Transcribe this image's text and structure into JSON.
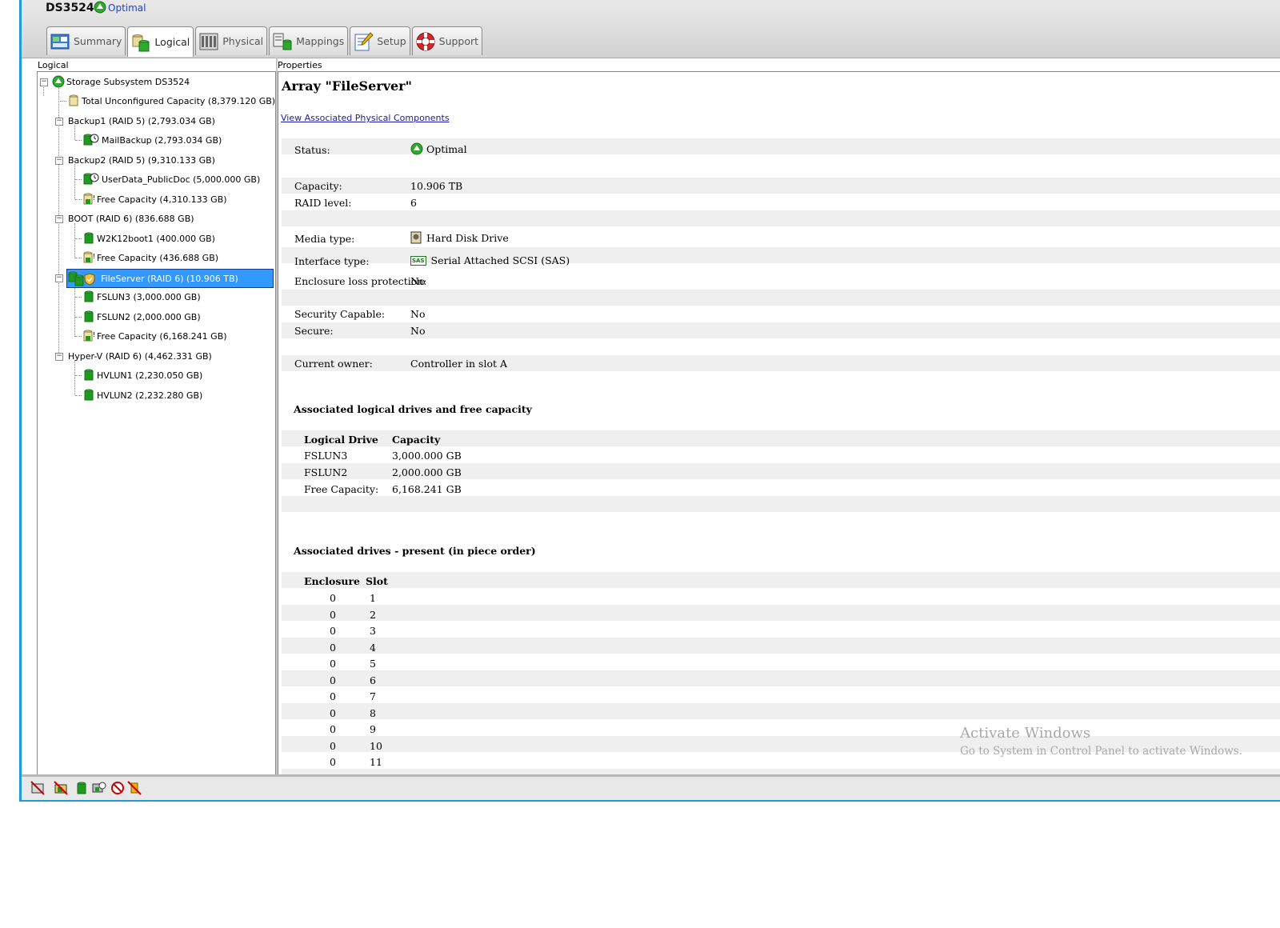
{
  "header": {
    "system_name": "DS3524",
    "status_text": "Optimal",
    "tabs": [
      {
        "label": "Summary"
      },
      {
        "label": "Logical"
      },
      {
        "label": "Physical"
      },
      {
        "label": "Mappings"
      },
      {
        "label": "Setup"
      },
      {
        "label": "Support"
      }
    ]
  },
  "left_panel": {
    "label": "Logical",
    "tree": [
      {
        "label": "Storage Subsystem DS3524",
        "icon": "storage-subsystem-icon"
      },
      {
        "label": "Total Unconfigured Capacity (8,379.120 GB)",
        "icon": "unconfigured-capacity-icon"
      },
      {
        "label": "Backup1 (RAID 5) (2,793.034 GB)",
        "icon": "array-icon"
      },
      {
        "label": "MailBackup (2,793.034 GB)",
        "icon": "logical-drive-clock-icon"
      },
      {
        "label": "Backup2 (RAID 5) (9,310.133 GB)",
        "icon": "array-icon"
      },
      {
        "label": "UserData_PublicDoc (5,000.000 GB)",
        "icon": "logical-drive-clock-icon"
      },
      {
        "label": "Free Capacity (4,310.133 GB)",
        "icon": "free-capacity-icon"
      },
      {
        "label": "BOOT (RAID 6) (836.688 GB)",
        "icon": "array-icon"
      },
      {
        "label": "W2K12boot1 (400.000 GB)",
        "icon": "logical-drive-icon"
      },
      {
        "label": "Free Capacity (436.688 GB)",
        "icon": "free-capacity-icon"
      },
      {
        "label": "FileServer (RAID 6) (10.906 TB)",
        "icon": "secure-array-icon"
      },
      {
        "label": "FSLUN3 (3,000.000 GB)",
        "icon": "logical-drive-icon"
      },
      {
        "label": "FSLUN2 (2,000.000 GB)",
        "icon": "logical-drive-icon"
      },
      {
        "label": "Free Capacity (6,168.241 GB)",
        "icon": "free-capacity-icon"
      },
      {
        "label": "Hyper-V (RAID 6) (4,462.331 GB)",
        "icon": "array-icon"
      },
      {
        "label": "HVLUN1 (2,230.050 GB)",
        "icon": "logical-drive-icon"
      },
      {
        "label": "HVLUN2 (2,232.280 GB)",
        "icon": "logical-drive-icon"
      }
    ]
  },
  "right_panel": {
    "label": "Properties",
    "title": "Array \"FileServer\"",
    "link": "View Associated Physical Components",
    "properties": [
      {
        "label": "Status:",
        "value": "Optimal"
      },
      {
        "label": "Capacity:",
        "value": "10.906 TB"
      },
      {
        "label": "RAID level:",
        "value": "6"
      },
      {
        "label": "Media type:",
        "value": "Hard Disk Drive"
      },
      {
        "label": "Interface type:",
        "value": "Serial Attached SCSI (SAS)"
      },
      {
        "label": "Enclosure loss protection:",
        "value": "No"
      },
      {
        "label": "Security Capable:",
        "value": "No"
      },
      {
        "label": "Secure:",
        "value": "No"
      },
      {
        "label": "Current owner:",
        "value": "Controller in slot A"
      }
    ],
    "sas_badge": "SAS",
    "logical_section": {
      "title": "Associated logical drives and free capacity",
      "headers": [
        "Logical Drive",
        "Capacity"
      ],
      "rows": [
        [
          "FSLUN3",
          "3,000.000 GB"
        ],
        [
          "FSLUN2",
          "2,000.000 GB"
        ],
        [
          "Free Capacity:",
          "6,168.241 GB"
        ]
      ]
    },
    "drives_section": {
      "title": "Associated drives - present (in piece order)",
      "headers": [
        "Enclosure",
        "Slot"
      ],
      "rows": [
        [
          "0",
          "1"
        ],
        [
          "0",
          "2"
        ],
        [
          "0",
          "3"
        ],
        [
          "0",
          "4"
        ],
        [
          "0",
          "5"
        ],
        [
          "0",
          "6"
        ],
        [
          "0",
          "7"
        ],
        [
          "0",
          "8"
        ],
        [
          "0",
          "9"
        ],
        [
          "0",
          "10"
        ],
        [
          "0",
          "11"
        ]
      ]
    }
  },
  "watermark": {
    "line1": "Activate Windows",
    "line2": "Go to System in Control Panel to activate Windows."
  },
  "colors": {
    "window_border": "#1f9bd6",
    "selection": "#3399ff",
    "status_green": "#2fa82f",
    "drive_green": "#1e9a1e",
    "link": "#1a1aa6"
  }
}
